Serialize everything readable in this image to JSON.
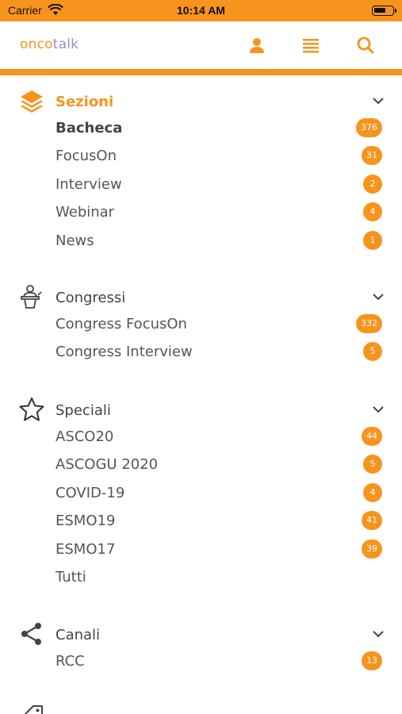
{
  "status_bar": {
    "carrier": "Carrier",
    "time": "10:14 AM"
  },
  "app_bar": {
    "logo_part1": "onco",
    "logo_part2": "talk",
    "icons": [
      "user-icon",
      "list-icon",
      "search-icon"
    ]
  },
  "colors": {
    "accent": "#f7941d",
    "logo_secondary": "#9b8fc8"
  },
  "sections": [
    {
      "title": "Sezioni",
      "icon": "layers-icon",
      "items": [
        {
          "label": "Bacheca",
          "count": "376"
        },
        {
          "label": "FocusOn",
          "count": "31"
        },
        {
          "label": "Interview",
          "count": "2"
        },
        {
          "label": "Webinar",
          "count": "4"
        },
        {
          "label": "News",
          "count": "1"
        }
      ]
    },
    {
      "title": "Congressi",
      "icon": "speaker-podium-icon",
      "items": [
        {
          "label": "Congress FocusOn",
          "count": "332"
        },
        {
          "label": "Congress Interview",
          "count": "5"
        }
      ]
    },
    {
      "title": "Speciali",
      "icon": "star-icon",
      "items": [
        {
          "label": "ASCO20",
          "count": "44"
        },
        {
          "label": "ASCOGU 2020",
          "count": "5"
        },
        {
          "label": "COVID-19",
          "count": "4"
        },
        {
          "label": "ESMO19",
          "count": "41"
        },
        {
          "label": "ESMO17",
          "count": "39"
        },
        {
          "label": "Tutti"
        }
      ]
    },
    {
      "title": "Canali",
      "icon": "share-icon",
      "items": [
        {
          "label": "RCC",
          "count": "13"
        }
      ]
    }
  ]
}
